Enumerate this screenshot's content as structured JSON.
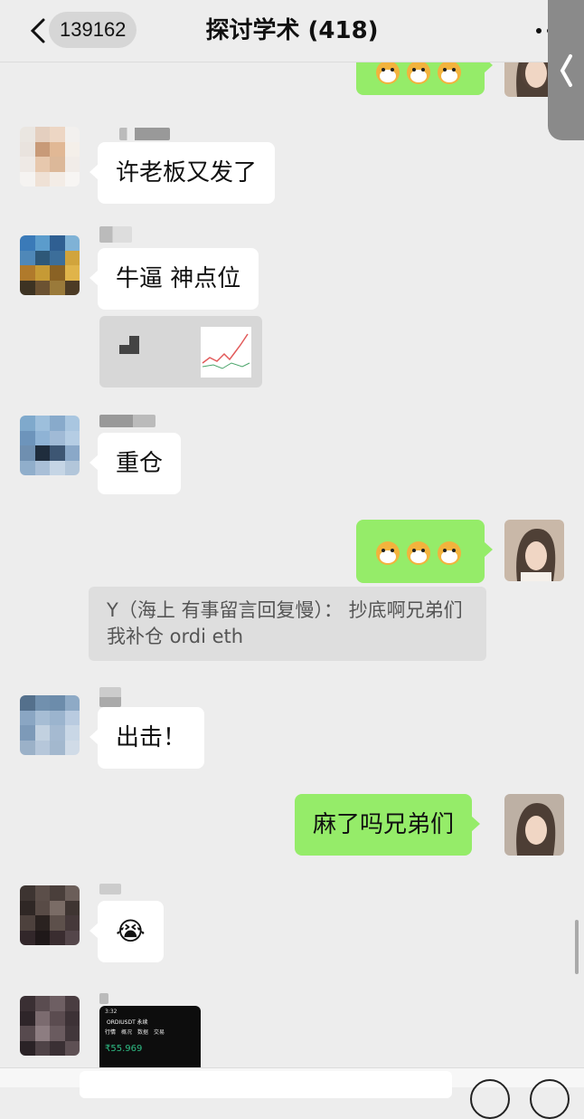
{
  "header": {
    "back_badge": "139162",
    "title": "探讨学术 (418)"
  },
  "messages": {
    "m1_text": "许老板又发了",
    "m2_text": "牛逼 神点位",
    "m3_text": "重仓",
    "quote_text": "Y（海上 有事留言回复慢）： 抄底啊兄弟们 我补仓 ordi eth",
    "m5_text": "出击！",
    "m6_text": "麻了吗兄弟们",
    "m7_emoji": "😭"
  },
  "shared_image": {
    "time": "3:32",
    "pair": "ORDIUSDT 永续",
    "tabs": [
      "行情",
      "概况",
      "数据",
      "交易"
    ],
    "price": "₹55.969"
  },
  "colors": {
    "self_bubble": "#95ec69",
    "other_bubble": "#ffffff",
    "background": "#ededed"
  }
}
